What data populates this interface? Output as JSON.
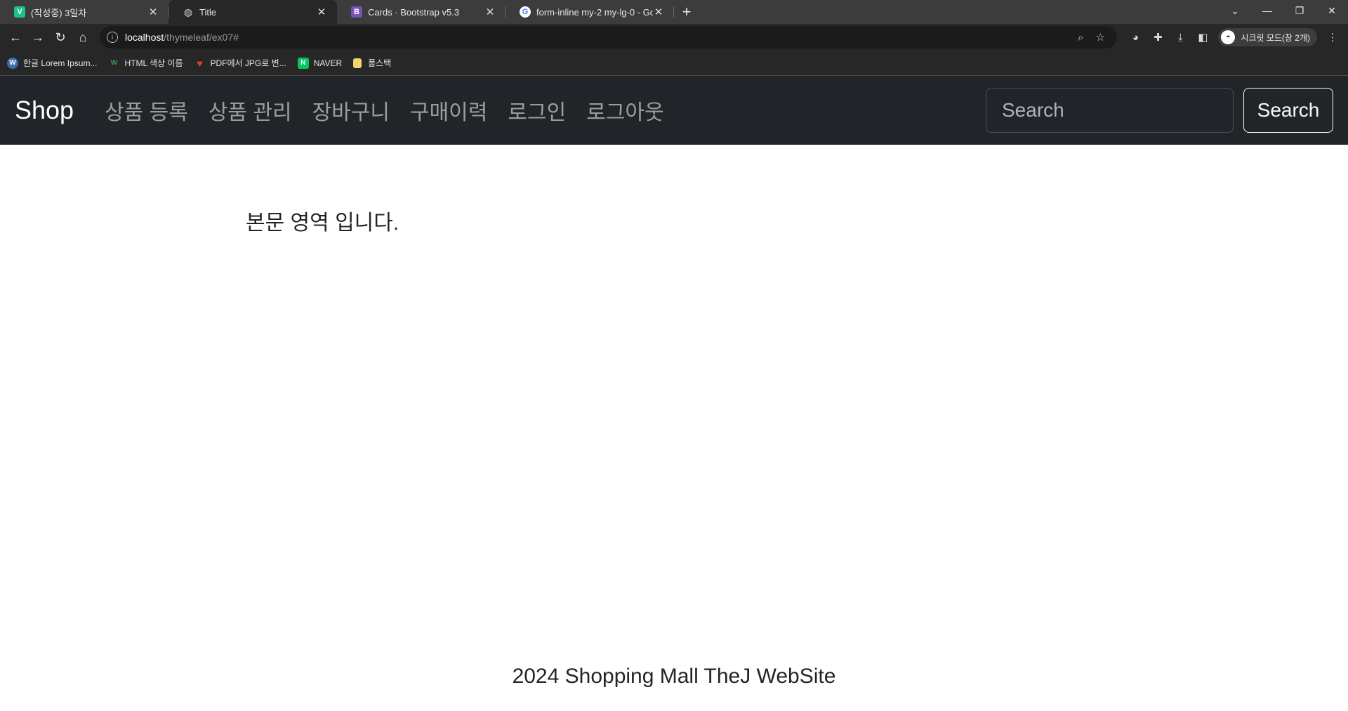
{
  "browser": {
    "tabs": [
      {
        "title": "(작성중) 3일차",
        "favicon": "V",
        "favicon_color": "#1ec08e",
        "active": false
      },
      {
        "title": "Title",
        "favicon": "globe",
        "active": true
      },
      {
        "title": "Cards · Bootstrap v5.3",
        "favicon": "B",
        "favicon_color": "#7952b3",
        "active": false
      },
      {
        "title": "form-inline my-2 my-lg-0 - Go",
        "favicon": "G",
        "favicon_color": "#ffffff",
        "active": false
      }
    ],
    "address": {
      "host": "localhost",
      "path": "/thymeleaf/ex07#"
    },
    "incognito_label": "시크릿 모드(창 2개)",
    "bookmarks": [
      {
        "label": "한글 Lorem Ipsum...",
        "icon": "wordpress-icon",
        "color": "#3b6fa8"
      },
      {
        "label": "HTML 색상 이름",
        "icon": "w-icon",
        "color": "#2e9f55"
      },
      {
        "label": "PDF에서 JPG로 변...",
        "icon": "heart-icon",
        "color": "#e23b3b"
      },
      {
        "label": "NAVER",
        "icon": "naver-icon",
        "color": "#03c75a"
      },
      {
        "label": "폴스택",
        "icon": "folder-icon",
        "color": "#f5d36b"
      }
    ]
  },
  "navbar": {
    "brand": "Shop",
    "links": [
      "상품 등록",
      "상품 관리",
      "장바구니",
      "구매이력",
      "로그인",
      "로그아웃"
    ],
    "search_placeholder": "Search",
    "search_button": "Search"
  },
  "main": {
    "text": "본문 영역 입니다."
  },
  "footer": {
    "text": "2024 Shopping Mall TheJ WebSite"
  }
}
